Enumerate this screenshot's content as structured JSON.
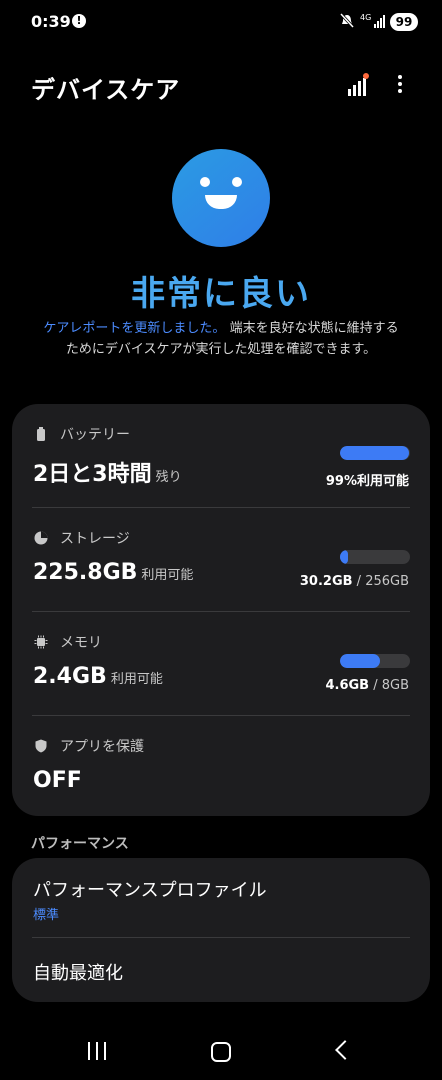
{
  "status_bar": {
    "time": "0:39",
    "network_label": "4G",
    "battery": "99"
  },
  "header": {
    "title": "デバイスケア"
  },
  "hero": {
    "status": "非常に良い",
    "link_text": "ケアレポートを更新しました。",
    "description": "端末を良好な状態に維持するためにデバイスケアが実行した処理を確認できます。"
  },
  "battery": {
    "label": "バッテリー",
    "value": "2日と3時間",
    "value_suffix": "残り",
    "available": "99%利用可能",
    "level": 0.99
  },
  "storage": {
    "label": "ストレージ",
    "value": "225.8GB",
    "value_suffix": "利用可能",
    "used": "30.2GB",
    "total": "256GB",
    "separator": " / ",
    "level": 0.12
  },
  "memory": {
    "label": "メモリ",
    "value": "2.4GB",
    "value_suffix": "利用可能",
    "used": "4.6GB",
    "total": "8GB",
    "separator": " / ",
    "level": 0.57
  },
  "app_protection": {
    "label": "アプリを保護",
    "value": "OFF"
  },
  "performance": {
    "section_label": "パフォーマンス",
    "profile_label": "パフォーマンスプロファイル",
    "profile_value": "標準",
    "auto_optimize_label": "自動最適化"
  },
  "colors": {
    "accent": "#3d7bf5",
    "status": "#4aa8f0",
    "card_bg": "#1d1d1f",
    "notification_dot": "#ff6a3d"
  },
  "icons": {
    "battery": "battery-icon",
    "storage": "pie-chart-icon",
    "memory": "chip-icon",
    "protection": "shield-icon"
  }
}
